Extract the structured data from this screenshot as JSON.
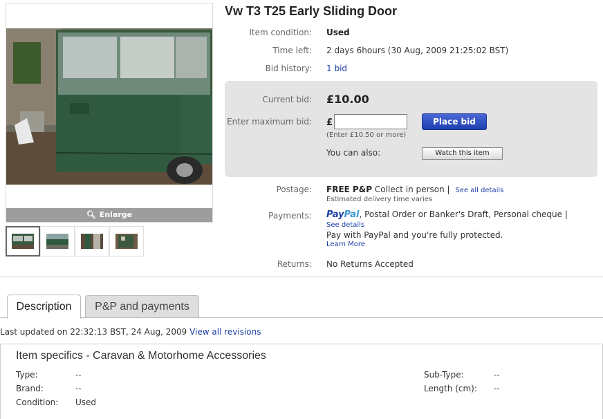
{
  "listing": {
    "title": "Vw T3 T25 Early Sliding Door"
  },
  "gallery": {
    "enlarge_label": "Enlarge",
    "thumbnail_count": 4
  },
  "details": {
    "condition_label": "Item condition:",
    "condition_value": "Used",
    "time_left_label": "Time left:",
    "time_left_value": "2 days 6hours (30 Aug, 2009  21:25:02 BST)",
    "bid_history_label": "Bid history:",
    "bid_history_value": "1 bid"
  },
  "bid": {
    "current_label": "Current bid:",
    "current_value": "£10.00",
    "max_label": "Enter maximum bid:",
    "currency_symbol": "£",
    "input_value": "",
    "place_bid_label": "Place bid",
    "hint": "(Enter £10.50 or more)",
    "also_label": "You can also:",
    "watch_label": "Watch this item"
  },
  "postage": {
    "label": "Postage:",
    "free": "FREE P&P",
    "collect": " Collect in person |",
    "see_all": "See all details",
    "delivery_note": "Estimated delivery time varies"
  },
  "payments": {
    "label": "Payments:",
    "paypal_part1": "Pay",
    "paypal_part2": "Pal",
    "methods": ", Postal Order or Banker's Draft, Personal cheque |",
    "see_details": "See details",
    "protection": "Pay with PayPal and you're fully protected.",
    "learn_more": "Learn More"
  },
  "returns": {
    "label": "Returns:",
    "value": "No Returns Accepted"
  },
  "tabs": {
    "description": "Description",
    "pp_payments": "P&P and payments"
  },
  "update": {
    "text": "Last updated on 22:32:13 BST, 24 Aug, 2009 ",
    "link": "View all revisions"
  },
  "specifics": {
    "title": "Item specifics - Caravan & Motorhome Accessories",
    "type_label": "Type:",
    "type_value": "--",
    "brand_label": "Brand:",
    "brand_value": "--",
    "condition_label": "Condition:",
    "condition_value": "Used",
    "subtype_label": "Sub-Type:",
    "subtype_value": "--",
    "length_label": "Length (cm):",
    "length_value": "--"
  }
}
